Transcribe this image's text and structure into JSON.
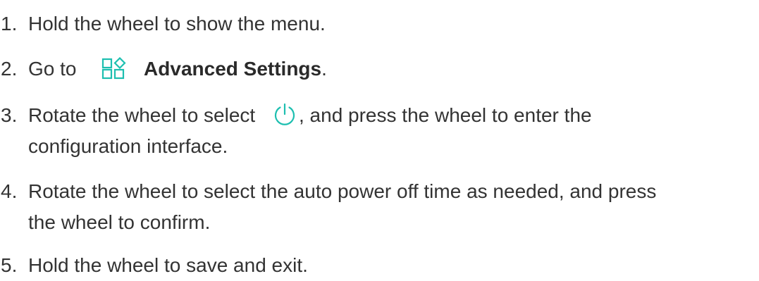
{
  "accent_color": "#1dbfb0",
  "steps": [
    {
      "number": "1.",
      "text": "Hold the wheel to show the menu."
    },
    {
      "number": "2.",
      "before": "Go to",
      "icon": "advanced-settings-grid-icon",
      "bold": "Advanced Settings",
      "after": "."
    },
    {
      "number": "3.",
      "before": "Rotate the wheel to select",
      "icon": "power-icon",
      "after": ", and press the wheel to enter the",
      "continuation": "configuration interface."
    },
    {
      "number": "4.",
      "text": "Rotate the wheel to select the auto power off time as needed, and press",
      "continuation": "the wheel to confirm."
    },
    {
      "number": "5.",
      "text": "Hold the wheel to save and exit."
    }
  ]
}
